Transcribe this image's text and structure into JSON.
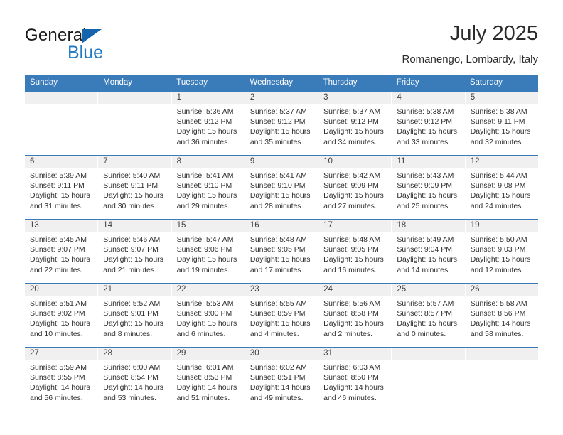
{
  "brand": {
    "name_top": "General",
    "name_bottom": "Blue",
    "accent_color": "#1f79c4",
    "triangle_color": "#1565ad"
  },
  "header": {
    "title": "July 2025",
    "subtitle": "Romanengo, Lombardy, Italy"
  },
  "theme": {
    "header_blue": "#3a7cba",
    "day_band_gray": "#f0f0f0",
    "text": "#2e2e2e"
  },
  "weekdays": [
    "Sunday",
    "Monday",
    "Tuesday",
    "Wednesday",
    "Thursday",
    "Friday",
    "Saturday"
  ],
  "weeks": [
    [
      {
        "day": "",
        "sunrise": "",
        "sunset": "",
        "daylight": "",
        "daylight2": ""
      },
      {
        "day": "",
        "sunrise": "",
        "sunset": "",
        "daylight": "",
        "daylight2": ""
      },
      {
        "day": "1",
        "sunrise": "Sunrise: 5:36 AM",
        "sunset": "Sunset: 9:12 PM",
        "daylight": "Daylight: 15 hours",
        "daylight2": "and 36 minutes."
      },
      {
        "day": "2",
        "sunrise": "Sunrise: 5:37 AM",
        "sunset": "Sunset: 9:12 PM",
        "daylight": "Daylight: 15 hours",
        "daylight2": "and 35 minutes."
      },
      {
        "day": "3",
        "sunrise": "Sunrise: 5:37 AM",
        "sunset": "Sunset: 9:12 PM",
        "daylight": "Daylight: 15 hours",
        "daylight2": "and 34 minutes."
      },
      {
        "day": "4",
        "sunrise": "Sunrise: 5:38 AM",
        "sunset": "Sunset: 9:12 PM",
        "daylight": "Daylight: 15 hours",
        "daylight2": "and 33 minutes."
      },
      {
        "day": "5",
        "sunrise": "Sunrise: 5:38 AM",
        "sunset": "Sunset: 9:11 PM",
        "daylight": "Daylight: 15 hours",
        "daylight2": "and 32 minutes."
      }
    ],
    [
      {
        "day": "6",
        "sunrise": "Sunrise: 5:39 AM",
        "sunset": "Sunset: 9:11 PM",
        "daylight": "Daylight: 15 hours",
        "daylight2": "and 31 minutes."
      },
      {
        "day": "7",
        "sunrise": "Sunrise: 5:40 AM",
        "sunset": "Sunset: 9:11 PM",
        "daylight": "Daylight: 15 hours",
        "daylight2": "and 30 minutes."
      },
      {
        "day": "8",
        "sunrise": "Sunrise: 5:41 AM",
        "sunset": "Sunset: 9:10 PM",
        "daylight": "Daylight: 15 hours",
        "daylight2": "and 29 minutes."
      },
      {
        "day": "9",
        "sunrise": "Sunrise: 5:41 AM",
        "sunset": "Sunset: 9:10 PM",
        "daylight": "Daylight: 15 hours",
        "daylight2": "and 28 minutes."
      },
      {
        "day": "10",
        "sunrise": "Sunrise: 5:42 AM",
        "sunset": "Sunset: 9:09 PM",
        "daylight": "Daylight: 15 hours",
        "daylight2": "and 27 minutes."
      },
      {
        "day": "11",
        "sunrise": "Sunrise: 5:43 AM",
        "sunset": "Sunset: 9:09 PM",
        "daylight": "Daylight: 15 hours",
        "daylight2": "and 25 minutes."
      },
      {
        "day": "12",
        "sunrise": "Sunrise: 5:44 AM",
        "sunset": "Sunset: 9:08 PM",
        "daylight": "Daylight: 15 hours",
        "daylight2": "and 24 minutes."
      }
    ],
    [
      {
        "day": "13",
        "sunrise": "Sunrise: 5:45 AM",
        "sunset": "Sunset: 9:07 PM",
        "daylight": "Daylight: 15 hours",
        "daylight2": "and 22 minutes."
      },
      {
        "day": "14",
        "sunrise": "Sunrise: 5:46 AM",
        "sunset": "Sunset: 9:07 PM",
        "daylight": "Daylight: 15 hours",
        "daylight2": "and 21 minutes."
      },
      {
        "day": "15",
        "sunrise": "Sunrise: 5:47 AM",
        "sunset": "Sunset: 9:06 PM",
        "daylight": "Daylight: 15 hours",
        "daylight2": "and 19 minutes."
      },
      {
        "day": "16",
        "sunrise": "Sunrise: 5:48 AM",
        "sunset": "Sunset: 9:05 PM",
        "daylight": "Daylight: 15 hours",
        "daylight2": "and 17 minutes."
      },
      {
        "day": "17",
        "sunrise": "Sunrise: 5:48 AM",
        "sunset": "Sunset: 9:05 PM",
        "daylight": "Daylight: 15 hours",
        "daylight2": "and 16 minutes."
      },
      {
        "day": "18",
        "sunrise": "Sunrise: 5:49 AM",
        "sunset": "Sunset: 9:04 PM",
        "daylight": "Daylight: 15 hours",
        "daylight2": "and 14 minutes."
      },
      {
        "day": "19",
        "sunrise": "Sunrise: 5:50 AM",
        "sunset": "Sunset: 9:03 PM",
        "daylight": "Daylight: 15 hours",
        "daylight2": "and 12 minutes."
      }
    ],
    [
      {
        "day": "20",
        "sunrise": "Sunrise: 5:51 AM",
        "sunset": "Sunset: 9:02 PM",
        "daylight": "Daylight: 15 hours",
        "daylight2": "and 10 minutes."
      },
      {
        "day": "21",
        "sunrise": "Sunrise: 5:52 AM",
        "sunset": "Sunset: 9:01 PM",
        "daylight": "Daylight: 15 hours",
        "daylight2": "and 8 minutes."
      },
      {
        "day": "22",
        "sunrise": "Sunrise: 5:53 AM",
        "sunset": "Sunset: 9:00 PM",
        "daylight": "Daylight: 15 hours",
        "daylight2": "and 6 minutes."
      },
      {
        "day": "23",
        "sunrise": "Sunrise: 5:55 AM",
        "sunset": "Sunset: 8:59 PM",
        "daylight": "Daylight: 15 hours",
        "daylight2": "and 4 minutes."
      },
      {
        "day": "24",
        "sunrise": "Sunrise: 5:56 AM",
        "sunset": "Sunset: 8:58 PM",
        "daylight": "Daylight: 15 hours",
        "daylight2": "and 2 minutes."
      },
      {
        "day": "25",
        "sunrise": "Sunrise: 5:57 AM",
        "sunset": "Sunset: 8:57 PM",
        "daylight": "Daylight: 15 hours",
        "daylight2": "and 0 minutes."
      },
      {
        "day": "26",
        "sunrise": "Sunrise: 5:58 AM",
        "sunset": "Sunset: 8:56 PM",
        "daylight": "Daylight: 14 hours",
        "daylight2": "and 58 minutes."
      }
    ],
    [
      {
        "day": "27",
        "sunrise": "Sunrise: 5:59 AM",
        "sunset": "Sunset: 8:55 PM",
        "daylight": "Daylight: 14 hours",
        "daylight2": "and 56 minutes."
      },
      {
        "day": "28",
        "sunrise": "Sunrise: 6:00 AM",
        "sunset": "Sunset: 8:54 PM",
        "daylight": "Daylight: 14 hours",
        "daylight2": "and 53 minutes."
      },
      {
        "day": "29",
        "sunrise": "Sunrise: 6:01 AM",
        "sunset": "Sunset: 8:53 PM",
        "daylight": "Daylight: 14 hours",
        "daylight2": "and 51 minutes."
      },
      {
        "day": "30",
        "sunrise": "Sunrise: 6:02 AM",
        "sunset": "Sunset: 8:51 PM",
        "daylight": "Daylight: 14 hours",
        "daylight2": "and 49 minutes."
      },
      {
        "day": "31",
        "sunrise": "Sunrise: 6:03 AM",
        "sunset": "Sunset: 8:50 PM",
        "daylight": "Daylight: 14 hours",
        "daylight2": "and 46 minutes."
      },
      {
        "day": "",
        "sunrise": "",
        "sunset": "",
        "daylight": "",
        "daylight2": ""
      },
      {
        "day": "",
        "sunrise": "",
        "sunset": "",
        "daylight": "",
        "daylight2": ""
      }
    ]
  ]
}
